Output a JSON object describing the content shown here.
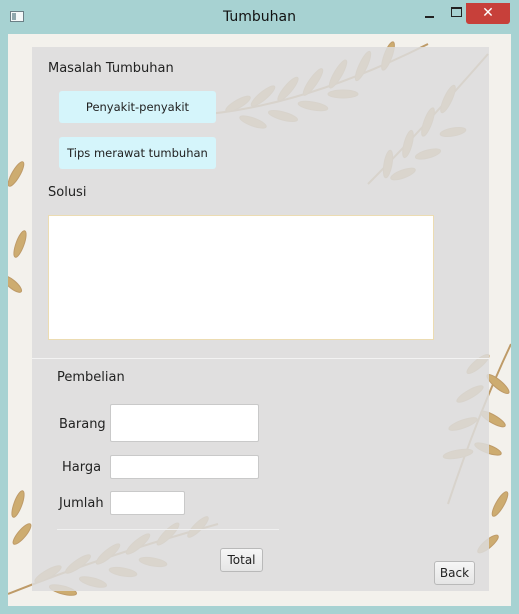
{
  "window": {
    "title": "Tumbuhan",
    "close_glyph": "✕"
  },
  "masalah": {
    "heading": "Masalah Tumbuhan",
    "btn_penyakit": "Penyakit-penyakit",
    "btn_tips": "Tips merawat tumbuhan"
  },
  "solusi": {
    "heading": "Solusi",
    "text": ""
  },
  "pembelian": {
    "heading": "Pembelian",
    "barang_label": "Barang",
    "barang_value": "",
    "harga_label": "Harga",
    "harga_value": "",
    "jumlah_label": "Jumlah",
    "jumlah_value": "",
    "total_button": "Total"
  },
  "footer": {
    "back_button": "Back"
  },
  "colors": {
    "titlebar": "#a7d2d2",
    "close": "#c7403a",
    "tip_button": "#d5f5fb",
    "leaf": "#c9a463"
  }
}
